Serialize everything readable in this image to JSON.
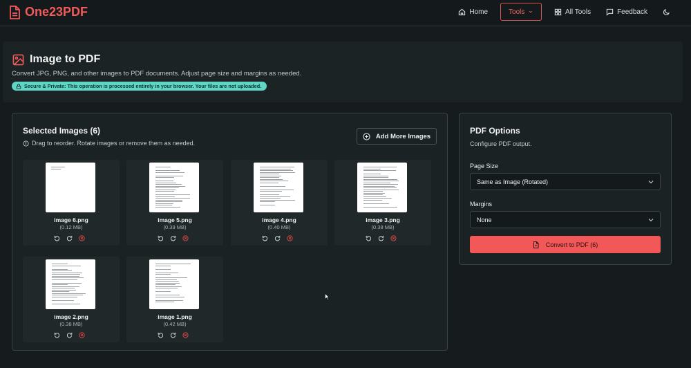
{
  "app": {
    "name": "One23PDF"
  },
  "nav": {
    "home": "Home",
    "tools": "Tools",
    "all_tools": "All Tools",
    "feedback": "Feedback"
  },
  "hero": {
    "title": "Image to PDF",
    "description": "Convert JPG, PNG, and other images to PDF documents. Adjust page size and margins as needed.",
    "badge": "Secure & Private: This operation is processed entirely in your browser. Your files are not uploaded."
  },
  "selected": {
    "title": "Selected Images (6)",
    "hint": "Drag to reorder. Rotate images or remove them as needed.",
    "add_label": "Add More Images",
    "images": [
      {
        "name": "image 6.png",
        "size": "(0.12 MB)"
      },
      {
        "name": "image 5.png",
        "size": "(0.39 MB)"
      },
      {
        "name": "image 4.png",
        "size": "(0.40 MB)"
      },
      {
        "name": "image 3.png",
        "size": "(0.38 MB)"
      },
      {
        "name": "image 2.png",
        "size": "(0.38 MB)"
      },
      {
        "name": "image 1.png",
        "size": "(0.42 MB)"
      }
    ]
  },
  "options": {
    "title": "PDF Options",
    "subtitle": "Configure PDF output.",
    "page_size_label": "Page Size",
    "page_size_value": "Same as Image (Rotated)",
    "margins_label": "Margins",
    "margins_value": "None",
    "convert_label": "Convert to PDF (6)"
  },
  "colors": {
    "accent": "#f25858",
    "badge": "#5fd6c5",
    "background": "#161c1d",
    "panel": "#1b2224"
  },
  "icons": [
    "file-text-icon",
    "home-icon",
    "chevron-down-icon",
    "grid-icon",
    "message-icon",
    "moon-icon",
    "image-icon",
    "lock-icon",
    "info-icon",
    "plus-circle-icon",
    "rotate-left-icon",
    "rotate-right-icon",
    "remove-icon",
    "file-icon"
  ]
}
